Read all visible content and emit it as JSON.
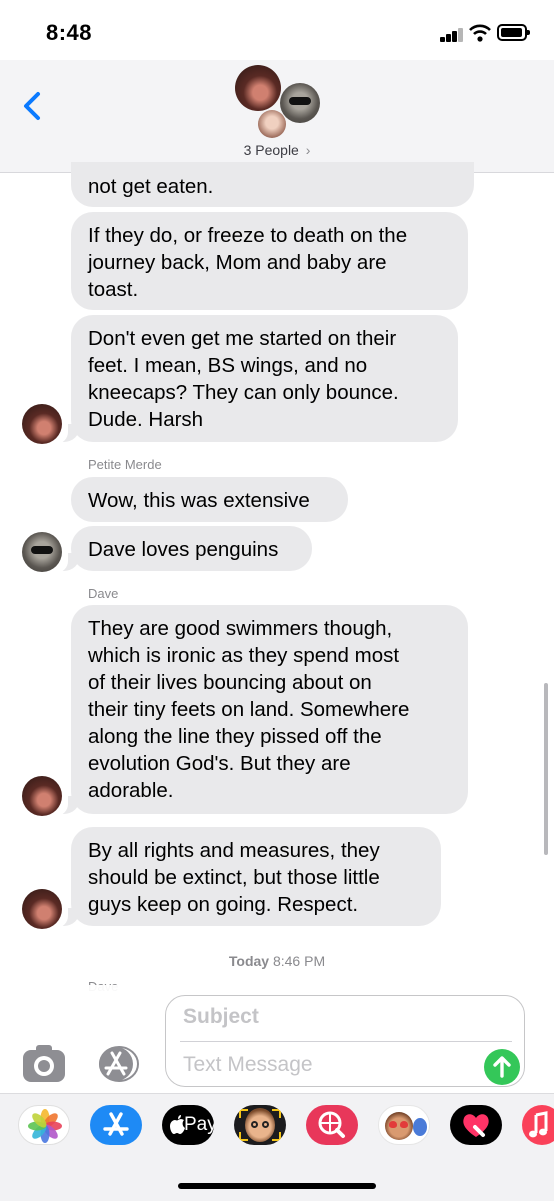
{
  "status": {
    "time": "8:48"
  },
  "header": {
    "people_label": "3 People",
    "chevron": "›"
  },
  "messages": {
    "m1": "not get eaten.",
    "m2": "If they do, or freeze to death on the\njourney back, Mom and baby are\ntoast.",
    "m3": "Don't even get me started on their\nfeet. I mean, BS wings, and no\nkneecaps? They can only bounce.\nDude. Harsh",
    "sender1": "Petite Merde",
    "m4": "Wow, this was extensive",
    "m5": "Dave loves penguins",
    "sender2": "Dave",
    "m6": "They are good swimmers though,\nwhich is ironic as they spend most\nof their lives bouncing about on\ntheir tiny feets on land. Somewhere\nalong the line they pissed off the\nevolution God's. But they are\nadorable.",
    "m7": "By all rights and measures, they\nshould be extinct, but those little\nguys keep on going. Respect.",
    "timestamp_day": "Today",
    "timestamp_time": "8:46 PM",
    "sender3": "Dave"
  },
  "compose": {
    "subject_placeholder": "Subject",
    "text_placeholder": "Text Message"
  },
  "apps": [
    {
      "name": "photos-icon",
      "color": "#ffffff"
    },
    {
      "name": "app-store-icon",
      "color": "#1e8af5"
    },
    {
      "name": "apple-pay-icon",
      "label": "Pay",
      "color": "#000000"
    },
    {
      "name": "memoji-icon",
      "color": "#1c1c1e"
    },
    {
      "name": "images-search-icon",
      "color": "#e8375a"
    },
    {
      "name": "memoji-stickers-icon",
      "color": "#ffffff"
    },
    {
      "name": "digital-touch-icon",
      "color": "#000000"
    },
    {
      "name": "music-icon",
      "color": "#fa4159"
    }
  ],
  "colors": {
    "accent": "#0a7aff",
    "bubble": "#e9e9eb",
    "send": "#34c759"
  }
}
